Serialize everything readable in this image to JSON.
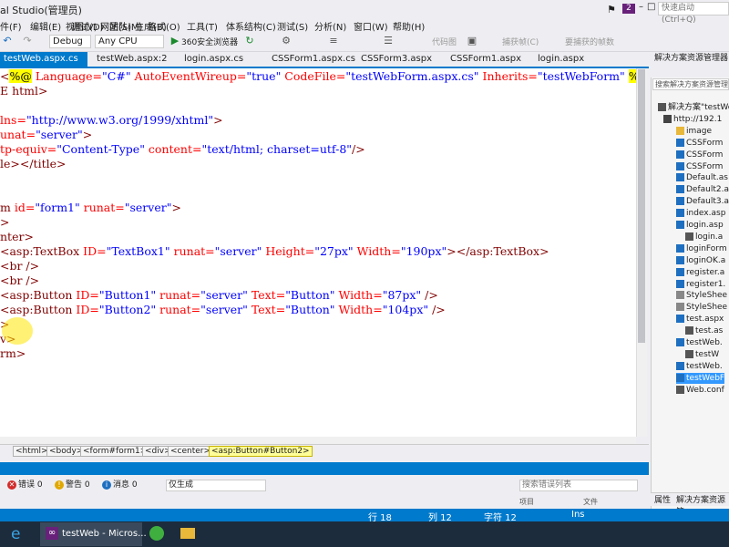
{
  "window": {
    "title": "al Studio(管理员)",
    "notifications": "2",
    "quick_launch": "快速启动 (Ctrl+Q)"
  },
  "menu": [
    "件(F)",
    "编辑(E)",
    "视图(V)",
    "网站(S)",
    "生成(B)",
    "调试(D)",
    "团队(M)",
    "格式(O)",
    "工具(T)",
    "体系结构(C)",
    "测试(S)",
    "分析(N)",
    "窗口(W)",
    "帮助(H)"
  ],
  "toolbar": {
    "config": "Debug",
    "platform": "Any CPU",
    "browser": "360安全浏览器",
    "btn_code": "代码图",
    "btn_capture": "捕获帧(C)",
    "btn_select": "要捕获的帧数"
  },
  "tabs": [
    "testWeb.aspx.cs",
    "testWeb.aspx:2",
    "login.aspx.cs",
    "CSSForm1.aspx.cs",
    "CSSForm3.aspx",
    "CSSForm1.aspx",
    "login.aspx"
  ],
  "editor": {
    "lines": [
      [
        [
          "t-tag",
          "<"
        ],
        [
          "t-dir",
          "%@"
        ],
        [
          "t-attr",
          " Language="
        ],
        [
          "t-val",
          "\"C#\""
        ],
        [
          "t-attr",
          " AutoEventWireup="
        ],
        [
          "t-val",
          "\"true\""
        ],
        [
          "t-attr",
          " CodeFile="
        ],
        [
          "t-val",
          "\"testWebForm.aspx.cs\""
        ],
        [
          "t-attr",
          " Inherits="
        ],
        [
          "t-val",
          "\"testWebForm\""
        ],
        [
          "t-text",
          " "
        ],
        [
          "t-dir",
          "%>"
        ]
      ],
      [
        [
          "t-tag",
          "E html>"
        ]
      ],
      [
        [
          "t-text",
          ""
        ]
      ],
      [
        [
          "t-attr",
          "lns="
        ],
        [
          "t-val",
          "\"http://www.w3.org/1999/xhtml\""
        ],
        [
          "t-tag",
          ">"
        ]
      ],
      [
        [
          "t-attr",
          "unat="
        ],
        [
          "t-val",
          "\"server\""
        ],
        [
          "t-tag",
          ">"
        ]
      ],
      [
        [
          "t-attr",
          "tp-equiv="
        ],
        [
          "t-val",
          "\"Content-Type\""
        ],
        [
          "t-attr",
          " content="
        ],
        [
          "t-val",
          "\"text/html; charset=utf-8\""
        ],
        [
          "t-tag",
          "/>"
        ]
      ],
      [
        [
          "t-tag",
          "le></title>"
        ]
      ],
      [
        [
          "t-text",
          ""
        ]
      ],
      [
        [
          "t-text",
          ""
        ]
      ],
      [
        [
          "t-tag",
          "m"
        ],
        [
          "t-attr",
          " id="
        ],
        [
          "t-val",
          "\"form1\""
        ],
        [
          "t-attr",
          " runat="
        ],
        [
          "t-val",
          "\"server\""
        ],
        [
          "t-tag",
          ">"
        ]
      ],
      [
        [
          "t-tag",
          ">"
        ]
      ],
      [
        [
          "t-tag",
          "nter>"
        ]
      ],
      [
        [
          "t-tag",
          "<asp:TextBox"
        ],
        [
          "t-attr",
          " ID="
        ],
        [
          "t-val",
          "\"TextBox1\""
        ],
        [
          "t-attr",
          " runat="
        ],
        [
          "t-val",
          "\"server\""
        ],
        [
          "t-attr",
          " Height="
        ],
        [
          "t-val",
          "\"27px\""
        ],
        [
          "t-attr",
          " Width="
        ],
        [
          "t-val",
          "\"190px\""
        ],
        [
          "t-tag",
          "></asp:TextBox>"
        ]
      ],
      [
        [
          "t-tag",
          "<br />"
        ]
      ],
      [
        [
          "t-tag",
          "<br />"
        ]
      ],
      [
        [
          "t-tag",
          "<asp:Button"
        ],
        [
          "t-attr",
          " ID="
        ],
        [
          "t-val",
          "\"Button1\""
        ],
        [
          "t-attr",
          " runat="
        ],
        [
          "t-val",
          "\"server\""
        ],
        [
          "t-attr",
          " Text="
        ],
        [
          "t-val",
          "\"Button\""
        ],
        [
          "t-attr",
          " Width="
        ],
        [
          "t-val",
          "\"87px\""
        ],
        [
          "t-tag",
          " />"
        ]
      ],
      [
        [
          "t-tag",
          "<asp:Button"
        ],
        [
          "t-attr",
          " ID="
        ],
        [
          "t-val",
          "\"Button2\""
        ],
        [
          "t-attr",
          " runat="
        ],
        [
          "t-val",
          "\"server\""
        ],
        [
          "t-attr",
          " Text="
        ],
        [
          "t-val",
          "\"Button\""
        ],
        [
          "t-attr",
          " Width="
        ],
        [
          "t-val",
          "\"104px\""
        ],
        [
          "t-tag",
          " />"
        ]
      ],
      [
        [
          "t-tag",
          ">"
        ]
      ],
      [
        [
          "t-tag",
          "v>"
        ]
      ],
      [
        [
          "t-tag",
          "rm>"
        ]
      ]
    ]
  },
  "breadcrumb": [
    "<html>",
    "<body>",
    "<form#form1>",
    "<div>",
    "<center>",
    "<asp:Button#Button2>"
  ],
  "errors": {
    "errors_label": "错误 0",
    "warnings_label": "警告 0",
    "messages_label": "消息 0",
    "build_filter": "仅生成",
    "search_placeholder": "搜索错误列表",
    "col_project": "项目",
    "col_file": "文件"
  },
  "solution": {
    "title": "解决方案资源管理器",
    "search": "搜索解决方案资源管理器",
    "items": [
      "解决方案\"testWe",
      "http://192.1",
      "image",
      "CSSForm",
      "CSSForm",
      "CSSForm",
      "Default.as",
      "Default2.a",
      "Default3.a",
      "index.asp",
      "login.asp",
      "login.a",
      "loginForm",
      "loginOK.a",
      "register.a",
      "register1.",
      "StyleShee",
      "StyleShee",
      "test.aspx",
      "test.as",
      "testWeb.",
      "testW",
      "testWeb.",
      "testWebF",
      "Web.conf"
    ],
    "tab_properties": "属性",
    "tab_solution": "解决方案资源管"
  },
  "status": {
    "row": "行 18",
    "col": "列 12",
    "char": "字符 12",
    "mode": "Ins"
  },
  "taskbar": {
    "vs_label": "testWeb - Micros..."
  }
}
